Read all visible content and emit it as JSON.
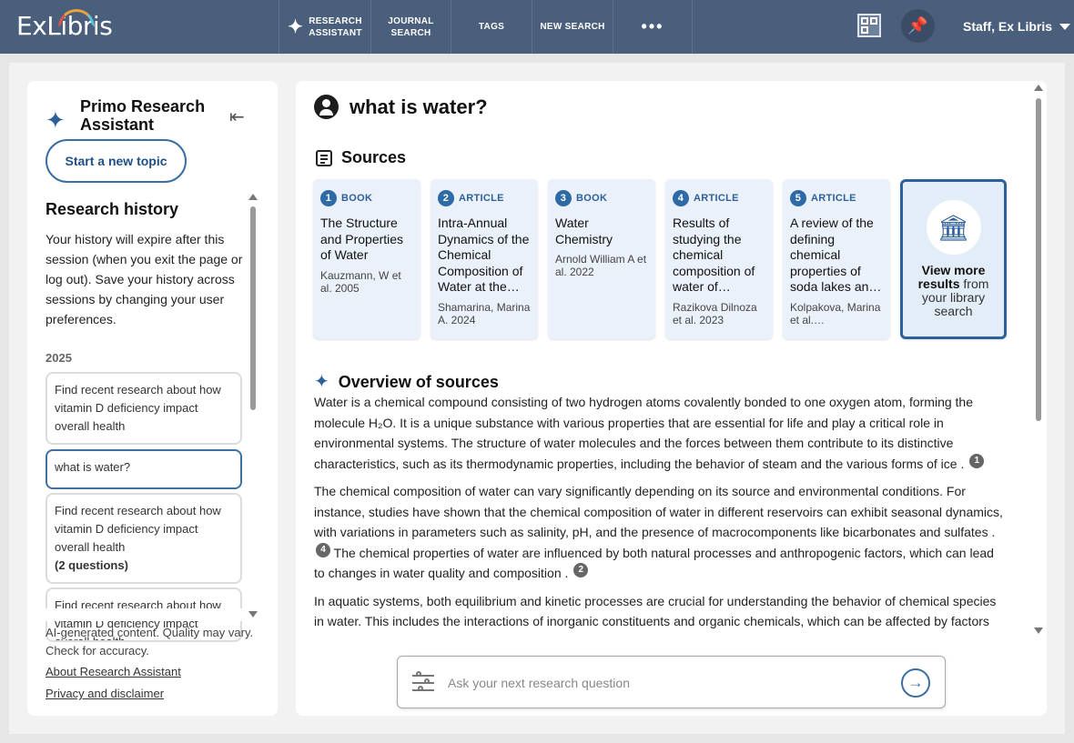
{
  "header": {
    "logo": "ExLibris",
    "nav": [
      {
        "label": "RESEARCH\nASSISTANT",
        "icon": "sparkle-icon"
      },
      {
        "label": "JOURNAL\nSEARCH"
      },
      {
        "label": "TAGS"
      },
      {
        "label": "NEW SEARCH"
      },
      {
        "label": "•••"
      }
    ],
    "user": "Staff, Ex Libris"
  },
  "sidebar": {
    "title": "Primo Research Assistant",
    "new_topic": "Start a new topic",
    "history_title": "Research history",
    "history_note": "Your history will expire after this session (when you exit the page or log out). Save your history across sessions by changing your user preferences.",
    "year": "2025",
    "items": [
      {
        "text": "Find recent research about how vitamin D deficiency impact overall health",
        "extra": ""
      },
      {
        "text": "what is water?",
        "extra": ""
      },
      {
        "text": "Find recent research about how vitamin D deficiency impact overall health",
        "extra": "(2 questions)"
      },
      {
        "text": "Find recent research about how vitamin D deficiency impact overall health",
        "extra": ""
      }
    ],
    "disclaimer": "AI-generated content. Quality may vary. Check for accuracy.",
    "about_link": "About Research Assistant",
    "privacy_link": "Privacy and disclaimer"
  },
  "main": {
    "question": "what is water?",
    "sources_title": "Sources",
    "sources": [
      {
        "num": "1",
        "type": "BOOK",
        "title": "The Structure and Properties of Water",
        "author": "Kauzmann, W et al. 2005"
      },
      {
        "num": "2",
        "type": "ARTICLE",
        "title": "Intra-Annual Dynamics of the Chemical Composition of Water at the…",
        "author": "Shamarina, Marina A. 2024"
      },
      {
        "num": "3",
        "type": "BOOK",
        "title": "Water Chemistry",
        "author": "Arnold William A et al. 2022"
      },
      {
        "num": "4",
        "type": "ARTICLE",
        "title": "Results of studying the chemical composition of water of…",
        "author": "Razikova Dilnoza et al. 2023"
      },
      {
        "num": "5",
        "type": "ARTICLE",
        "title": "A review of the defining chemical properties of soda lakes an…",
        "author": "Kolpakova, Marina et al.…"
      }
    ],
    "more_results": {
      "bold1": "View more",
      "bold2": "results",
      "rest1": " from",
      "rest2": "your library search"
    },
    "overview_title": "Overview of sources",
    "paragraphs": {
      "p1": "Water is a chemical compound consisting of two hydrogen atoms covalently bonded to one oxygen atom, forming the molecule H₂O. It is a unique substance with various properties that are essential for life and play a critical role in environmental systems. The structure of water molecules and the forces between them contribute to its distinctive characteristics, such as its thermodynamic properties, including the behavior of steam and the various forms of ice .",
      "p1_cite": "1",
      "p2a": "The chemical composition of water can vary significantly depending on its source and environmental conditions. For instance, studies have shown that the chemical composition of water in different reservoirs can exhibit seasonal dynamics, with variations in parameters such as salinity, pH, and the presence of macrocomponents like bicarbonates and sulfates .",
      "p2a_cite": "4",
      "p2b": " The chemical properties of water are influenced by both natural processes and anthropogenic factors, which can lead to changes in water quality and composition .",
      "p2b_cite": "2",
      "p3": "In aquatic systems, both equilibrium and kinetic processes are crucial for understanding the behavior of chemical species in water. This includes the interactions of inorganic constituents and organic chemicals, which can be affected by factors"
    },
    "ask_placeholder": "Ask your next research question"
  }
}
